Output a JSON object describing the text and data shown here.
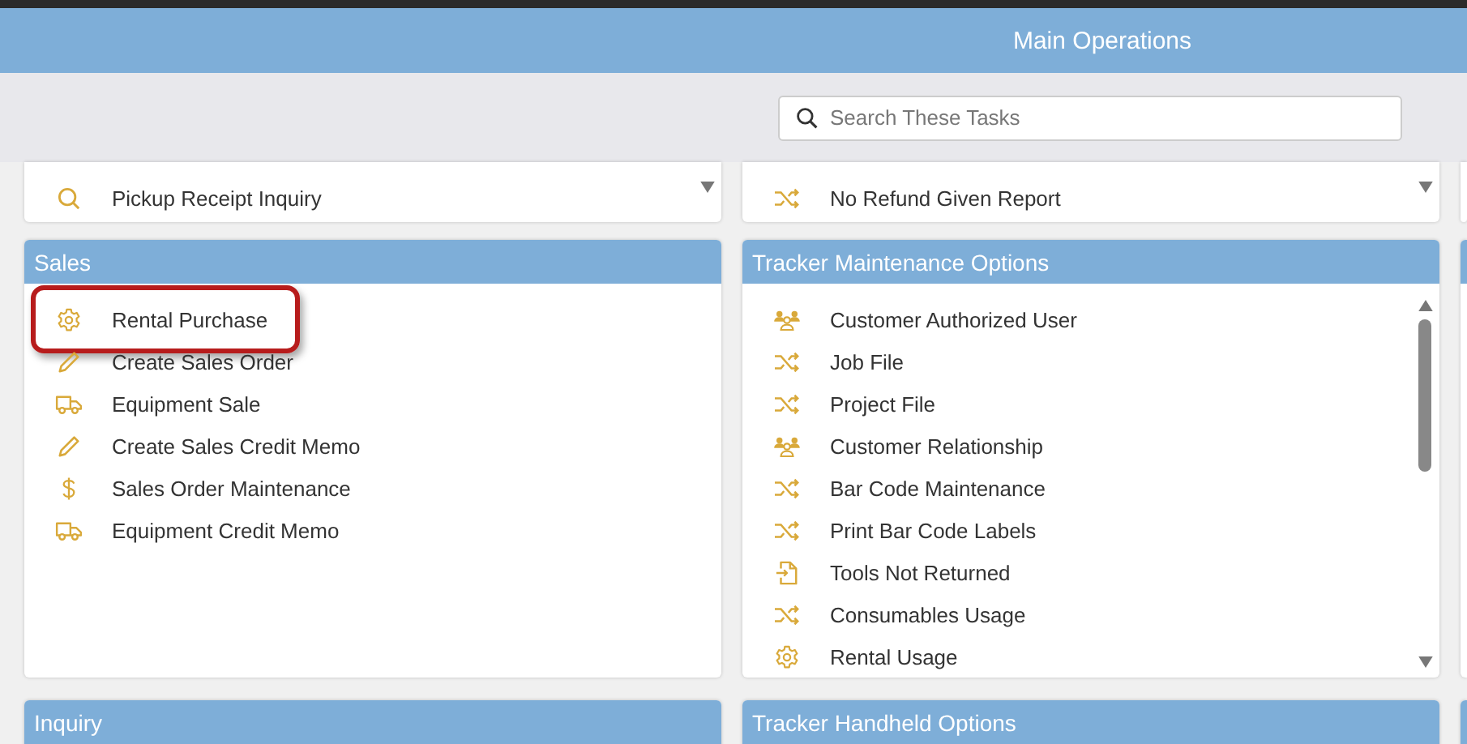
{
  "header": {
    "title": "Main Operations"
  },
  "search": {
    "placeholder": "Search These Tasks"
  },
  "top_panels": [
    {
      "items": [
        {
          "label": "Pickup Receipt Inquiry",
          "kind": "search"
        }
      ]
    },
    {
      "items": [
        {
          "label": "No Refund Given Report",
          "kind": "shuffle"
        }
      ]
    }
  ],
  "panels": [
    {
      "title": "Sales",
      "scrollbar": false,
      "items": [
        {
          "label": "Rental Purchase",
          "kind": "gear",
          "highlighted": true
        },
        {
          "label": "Create Sales Order",
          "kind": "pencil",
          "highlighted": false
        },
        {
          "label": "Equipment Sale",
          "kind": "truck",
          "highlighted": false
        },
        {
          "label": "Create Sales Credit Memo",
          "kind": "pencil",
          "highlighted": false
        },
        {
          "label": "Sales Order Maintenance",
          "kind": "dollar",
          "highlighted": false
        },
        {
          "label": "Equipment Credit Memo",
          "kind": "truck",
          "highlighted": false
        }
      ]
    },
    {
      "title": "Tracker Maintenance Options",
      "scrollbar": true,
      "items": [
        {
          "label": "Customer Authorized User",
          "kind": "users",
          "highlighted": false
        },
        {
          "label": "Job File",
          "kind": "shuffle",
          "highlighted": false
        },
        {
          "label": "Project File",
          "kind": "shuffle",
          "highlighted": false
        },
        {
          "label": "Customer Relationship",
          "kind": "users",
          "highlighted": false
        },
        {
          "label": "Bar Code Maintenance",
          "kind": "shuffle",
          "highlighted": false
        },
        {
          "label": "Print Bar Code Labels",
          "kind": "shuffle",
          "highlighted": false
        },
        {
          "label": "Tools Not Returned",
          "kind": "filein",
          "highlighted": false
        },
        {
          "label": "Consumables Usage",
          "kind": "shuffle",
          "highlighted": false
        },
        {
          "label": "Rental Usage",
          "kind": "gear",
          "highlighted": false
        }
      ]
    }
  ],
  "bottom_panels": [
    {
      "title": "Inquiry"
    },
    {
      "title": "Tracker Handheld Options"
    }
  ]
}
